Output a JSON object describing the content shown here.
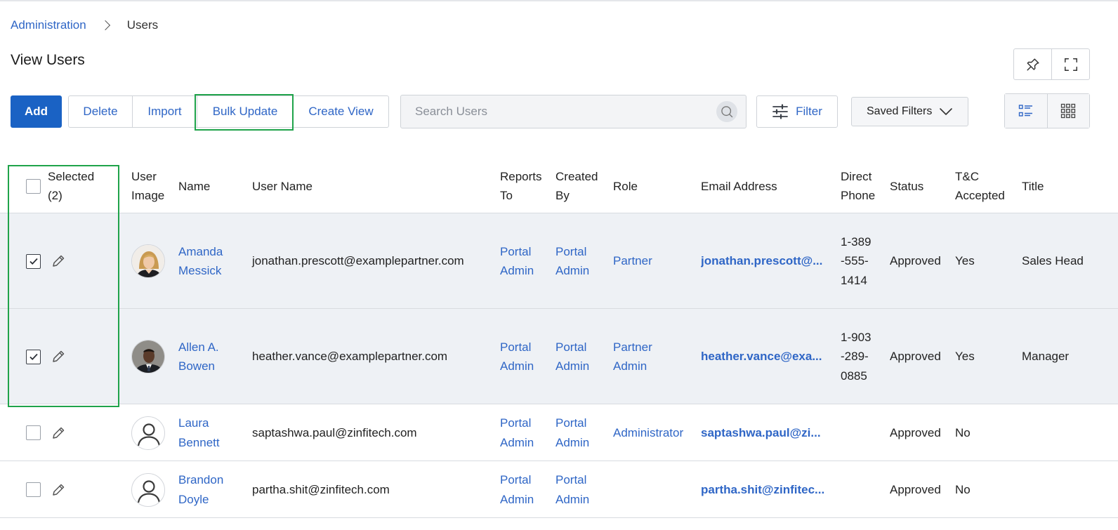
{
  "breadcrumb": {
    "parent": "Administration",
    "current": "Users"
  },
  "page_title": "View Users",
  "toolbar": {
    "add": "Add",
    "delete": "Delete",
    "import": "Import",
    "bulk_update": "Bulk Update",
    "create_view": "Create View",
    "filter": "Filter",
    "saved_filters": "Saved Filters"
  },
  "search": {
    "placeholder": "Search Users",
    "value": ""
  },
  "icons": {
    "pin": "pin-icon",
    "fullscreen": "fullscreen-icon",
    "search": "search-icon",
    "filter": "sliders-icon",
    "saved_filters": "chevron-down-icon",
    "list_view": "list-view-icon",
    "grid_view": "grid-view-icon",
    "edit": "pencil-icon",
    "checkbox": "checkbox-icon"
  },
  "colors": {
    "primary": "#1a62c4",
    "link": "#2f66c6",
    "highlight": "#1fa34a",
    "selected_row": "#eef1f5"
  },
  "table": {
    "headers": {
      "selected": "Selected (2)",
      "user_image": "User Image",
      "name": "Name",
      "user_name": "User Name",
      "reports_to": "Reports To",
      "created_by": "Created By",
      "role": "Role",
      "email": "Email Address",
      "direct_phone": "Direct Phone",
      "status": "Status",
      "tc_accepted": "T&C Accepted",
      "title": "Title"
    },
    "rows": [
      {
        "selected": true,
        "name": "Amanda Messick",
        "user_name": "jonathan.prescott@examplepartner.com",
        "reports_to": "Portal Admin",
        "created_by": "Portal Admin",
        "role": "Partner",
        "email": "jonathan.prescott@...",
        "phone": "1-389-555-1414",
        "status": "Approved",
        "tc": "Yes",
        "title": "Sales Head",
        "avatar": "photo-woman-blonde"
      },
      {
        "selected": true,
        "name": "Allen A. Bowen",
        "user_name": "heather.vance@examplepartner.com",
        "reports_to": "Portal Admin",
        "created_by": "Portal Admin",
        "role": "Partner Admin",
        "email": "heather.vance@exa...",
        "phone": "1-903-289-0885",
        "status": "Approved",
        "tc": "Yes",
        "title": "Manager",
        "avatar": "photo-man-suit"
      },
      {
        "selected": false,
        "name": "Laura Bennett",
        "user_name": "saptashwa.paul@zinfitech.com",
        "reports_to": "Portal Admin",
        "created_by": "Portal Admin",
        "role": "Administrator",
        "email": "saptashwa.paul@zi...",
        "phone": "",
        "status": "Approved",
        "tc": "No",
        "title": "",
        "avatar": "default-user-icon"
      },
      {
        "selected": false,
        "name": "Brandon Doyle",
        "user_name": "partha.shit@zinfitech.com",
        "reports_to": "Portal Admin",
        "created_by": "Portal Admin",
        "role": "",
        "email": "partha.shit@zinfitec...",
        "phone": "",
        "status": "Approved",
        "tc": "No",
        "title": "",
        "avatar": "default-user-icon"
      }
    ]
  }
}
